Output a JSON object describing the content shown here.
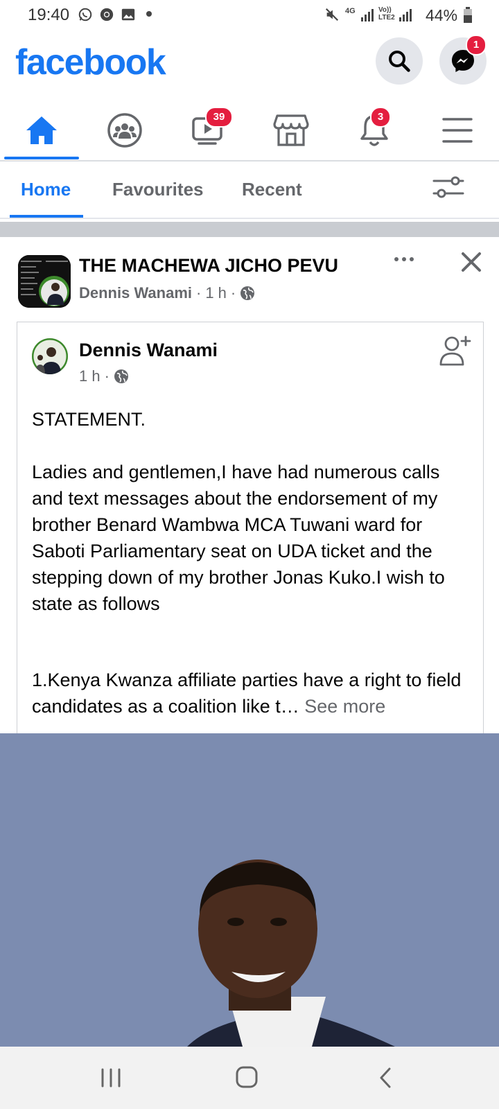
{
  "status_bar": {
    "time": "19:40",
    "battery": "44%",
    "network": "4G",
    "network2": "Vo)) LTE2",
    "left_icons": [
      "whatsapp-icon",
      "chrome-icon",
      "gallery-icon",
      "dot-icon"
    ],
    "right_icons": [
      "mute-icon",
      "signal-icon",
      "battery-icon"
    ]
  },
  "header": {
    "logo": "facebook",
    "messenger_badge": "1",
    "brand_color": "#1877f2"
  },
  "nav": {
    "tabs": [
      {
        "name": "home-icon",
        "active": true
      },
      {
        "name": "groups-icon"
      },
      {
        "name": "watch-icon",
        "badge": "39"
      },
      {
        "name": "marketplace-icon"
      },
      {
        "name": "notifications-icon",
        "badge": "3"
      },
      {
        "name": "menu-icon"
      }
    ]
  },
  "feed_tabs": {
    "home": "Home",
    "favourites": "Favourites",
    "recent": "Recent"
  },
  "post": {
    "group_name": "THE MACHEWA JICHO PEVU",
    "poster": "Dennis Wanami",
    "time": "1 h",
    "dot": "·",
    "shared": {
      "author": "Dennis Wanami",
      "time": "1 h",
      "line1": "STATEMENT.",
      "para1": "Ladies and gentlemen,I have had numerous calls and text messages about the endorsement of  my brother Benard Wambwa MCA Tuwani ward for Saboti Parliamentary seat on UDA ticket and the stepping down of my brother Jonas Kuko.I wish to state as follows",
      "para2": "1.Kenya Kwanza affiliate parties have a right to field candidates as a coalition like t…",
      "see_more": "See more"
    }
  }
}
